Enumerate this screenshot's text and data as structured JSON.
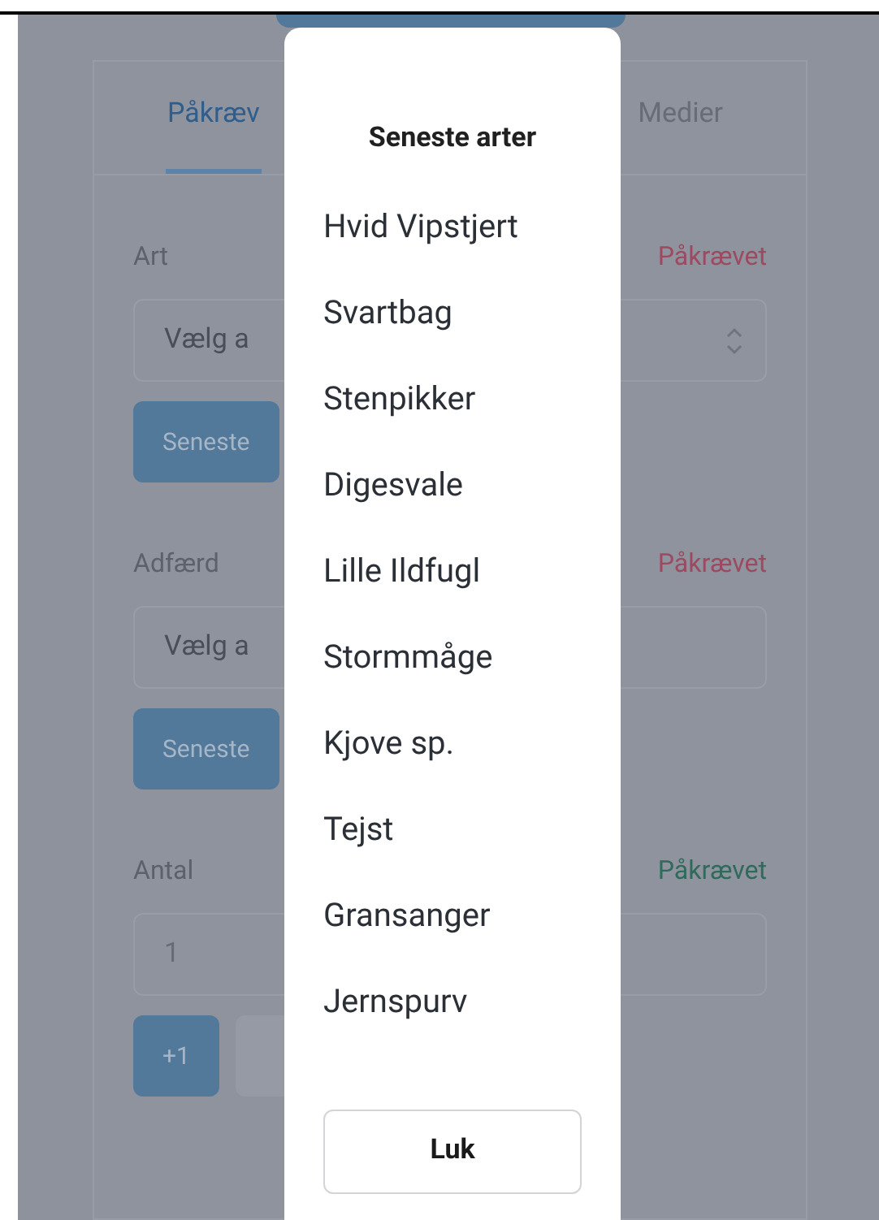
{
  "tabs": [
    {
      "label": "Påkræv",
      "selected": true
    },
    {
      "label": "Medier",
      "selected": false
    }
  ],
  "fields": [
    {
      "label": "Art",
      "status": "Påkrævet",
      "color": "#9c4a60",
      "kind": "select",
      "placeholder": "Vælg a",
      "buttons": [
        {
          "kind": "primary",
          "label": "Seneste"
        }
      ]
    },
    {
      "label": "Adfærd",
      "status": "Påkrævet",
      "color": "#9c4a60",
      "kind": "text",
      "placeholder": "Vælg a",
      "buttons": [
        {
          "kind": "primary",
          "label": "Seneste"
        }
      ]
    },
    {
      "label": "Antal",
      "status": "Påkrævet",
      "color": "#2f6a5a",
      "kind": "number",
      "value": "1",
      "buttons": [
        {
          "kind": "primary",
          "label": "+1"
        },
        {
          "kind": "secondary"
        }
      ]
    }
  ],
  "dialog": {
    "title": "Seneste arter",
    "items": [
      "Hvid Vipstjert",
      "Svartbag",
      "Stenpikker",
      "Digesvale",
      "Lille Ildfugl",
      "Stormmåge",
      "Kjove sp.",
      "Tejst",
      "Gransanger",
      "Jernspurv"
    ],
    "close_button": "Luk"
  }
}
